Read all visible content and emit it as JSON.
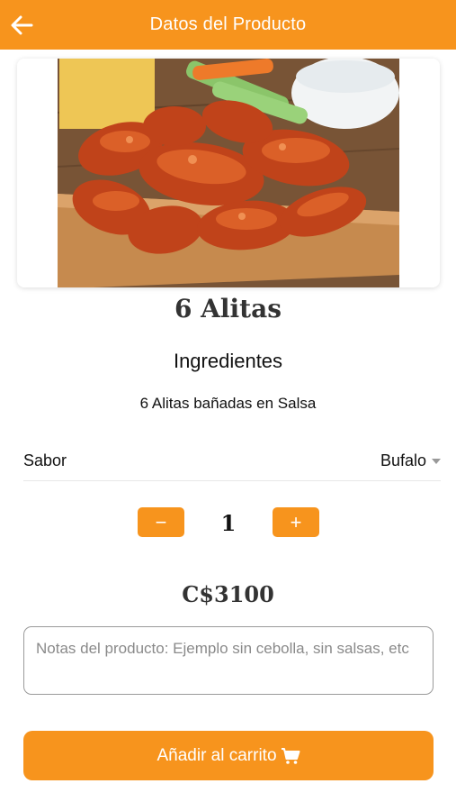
{
  "header": {
    "title": "Datos del Producto",
    "back_icon": "arrow-left-icon"
  },
  "colors": {
    "accent": "#f7941d",
    "text": "#111111",
    "border": "#9a9a9a"
  },
  "product": {
    "name": "6 Alitas",
    "image_icon": "chicken-wings-photo",
    "ingredients_title": "Ingredientes",
    "ingredients_text": "6 Alitas bañadas en Salsa"
  },
  "flavor": {
    "label": "Sabor",
    "selected": "Bufalo"
  },
  "quantity": {
    "minus": "−",
    "value": "1",
    "plus": "+"
  },
  "price": "C$3100",
  "notes": {
    "placeholder": "Notas del producto: Ejemplo sin cebolla, sin salsas, etc",
    "value": ""
  },
  "cart_button": {
    "label": "Añadir al carrito",
    "icon": "cart-icon"
  }
}
